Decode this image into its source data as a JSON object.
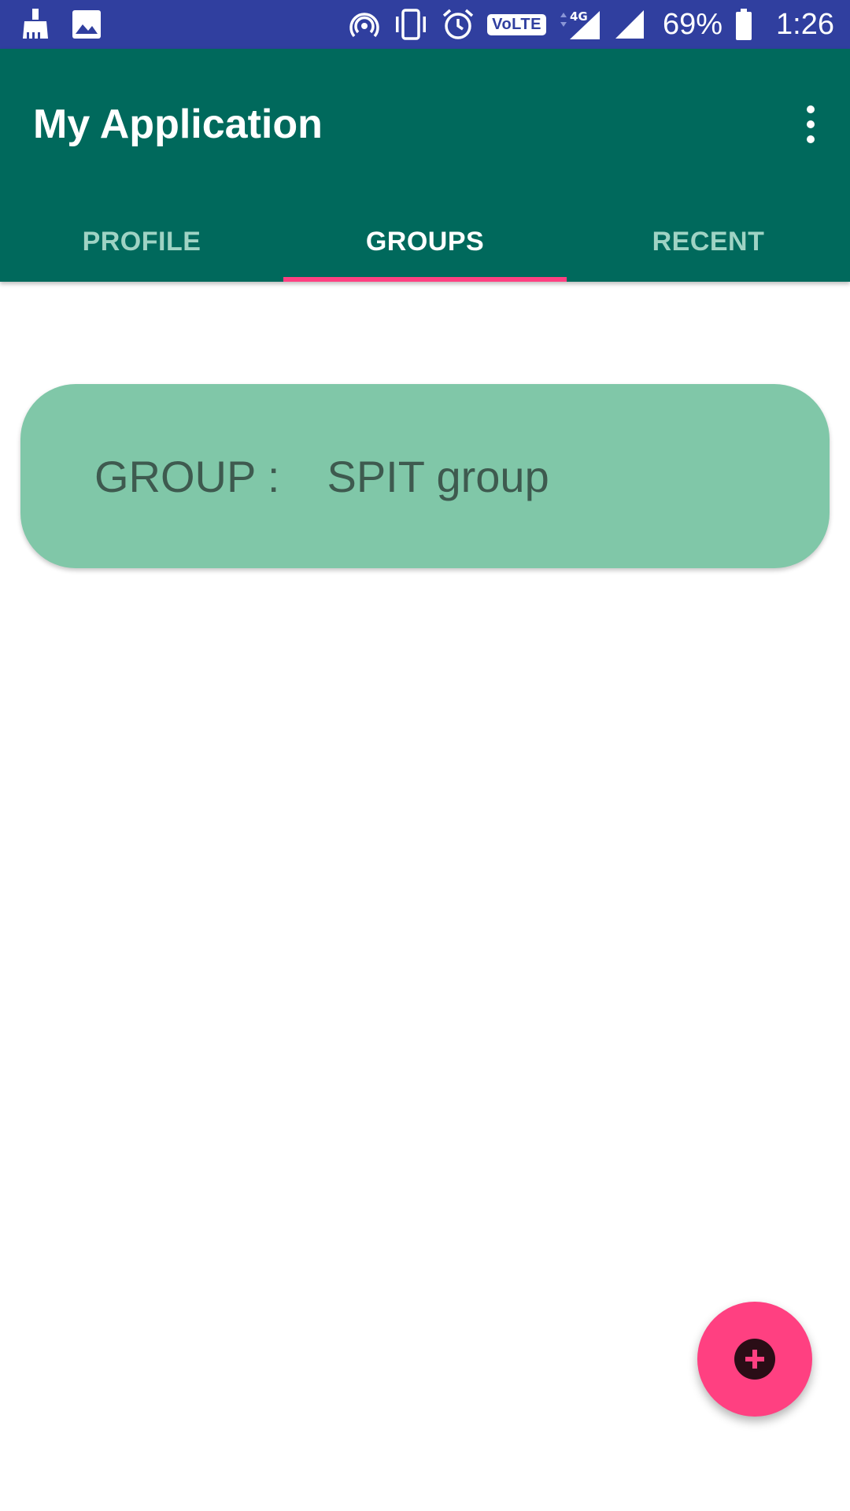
{
  "status_bar": {
    "battery_percent": "69%",
    "time": "1:26",
    "volte": "VoLTE",
    "network": "4G",
    "icons": [
      "cleaner-icon",
      "image-icon",
      "hotspot-icon",
      "vibrate-icon",
      "alarm-icon",
      "volte-icon",
      "network-4g-icon",
      "signal-icon",
      "battery-icon"
    ],
    "color": "#303f9f"
  },
  "app_bar": {
    "title": "My Application",
    "color": "#00695c",
    "overflow_icon": "more-vert-icon"
  },
  "tabs": [
    {
      "label": "PROFILE",
      "active": false
    },
    {
      "label": "GROUPS",
      "active": true
    },
    {
      "label": "RECENT",
      "active": false
    }
  ],
  "tab_indicator_color": "#ff4081",
  "group_card": {
    "label": "GROUP :",
    "value": "SPIT group",
    "color": "#80c7a8"
  },
  "fab": {
    "icon": "add-circle-icon",
    "color": "#ff4081"
  }
}
